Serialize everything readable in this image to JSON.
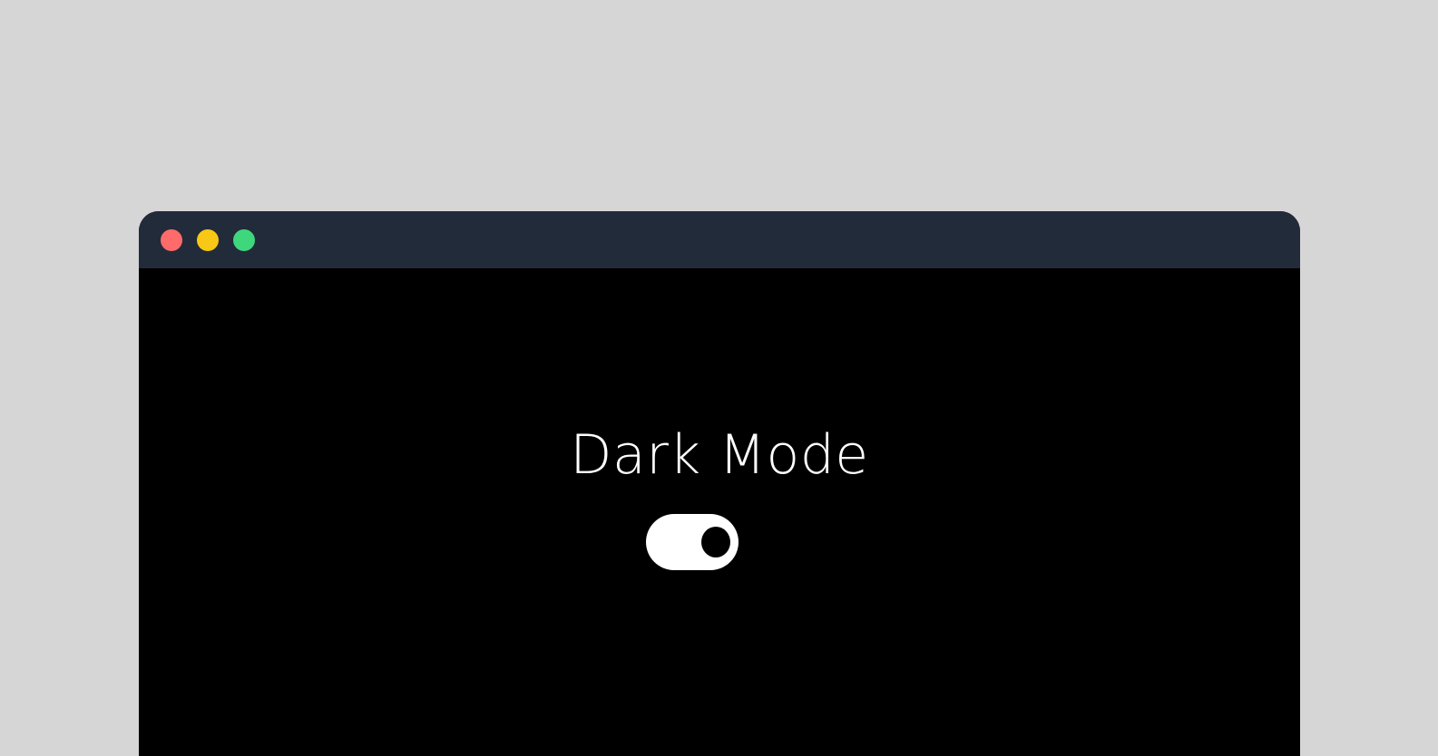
{
  "window": {
    "controls": [
      {
        "name": "close",
        "color": "#ff6b6b"
      },
      {
        "name": "minimize",
        "color": "#f7c815"
      },
      {
        "name": "maximize",
        "color": "#3fd77c"
      }
    ]
  },
  "main": {
    "title": "Dark Mode",
    "toggle": {
      "state": "on",
      "track_color": "#ffffff",
      "knob_color": "#000000"
    }
  }
}
